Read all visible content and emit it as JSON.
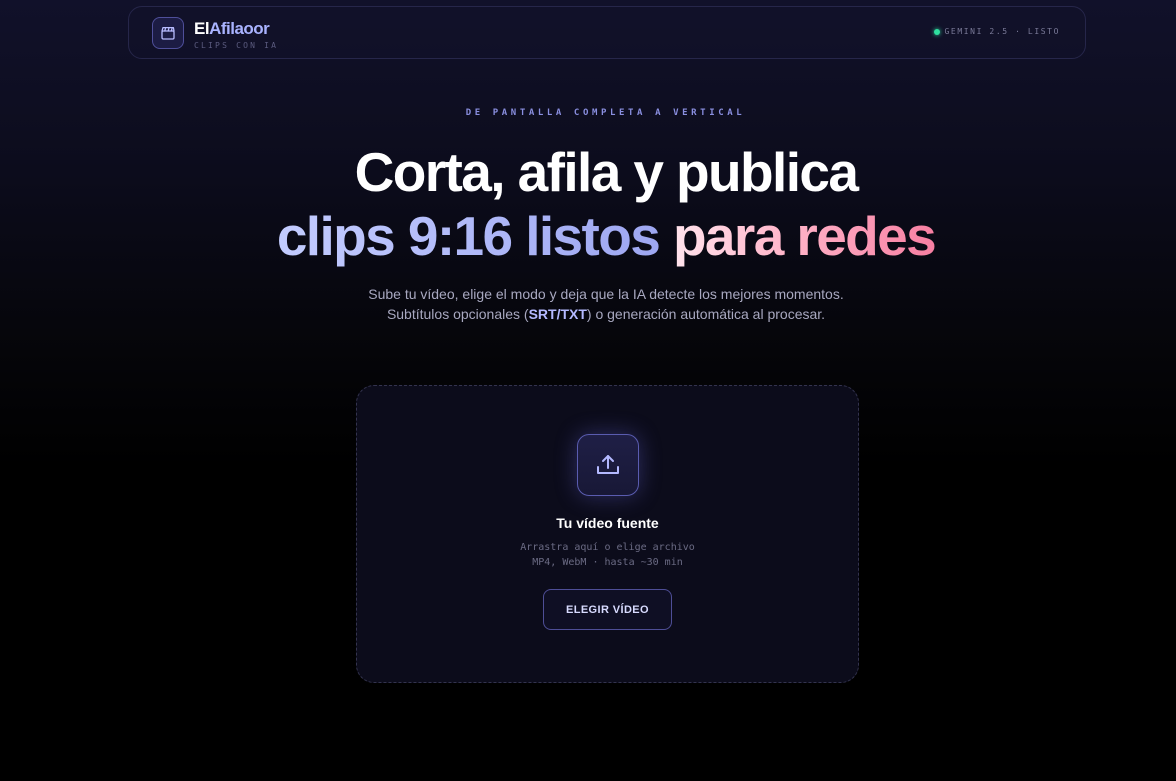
{
  "header": {
    "brand_part1": "El",
    "brand_part2": "Afilaoor",
    "tagline": "CLIPS CON IA",
    "status": "GEMINI 2.5 · LISTO",
    "status_color": "#2fe0a0",
    "logo_icon": "clapperboard-icon"
  },
  "hero": {
    "eyebrow": "DE PANTALLA COMPLETA A VERTICAL",
    "line1": "Corta, afila y publica",
    "line2_part1": "clips 9:16 listos",
    "line2_part2": "para redes",
    "desc_line1": "Sube tu vídeo, elige el modo y deja que la IA detecte los mejores momentos.",
    "desc_line2_pre": "Subtítulos opcionales (",
    "desc_line2_hl": "SRT/TXT",
    "desc_line2_post": ") o generación automática al procesar."
  },
  "upload": {
    "icon": "upload-icon",
    "title": "Tu vídeo fuente",
    "hint1": "Arrastra aquí o elige archivo",
    "hint2": "MP4, WebM · hasta ~30 min",
    "button_label": "ELEGIR VÍDEO"
  },
  "colors": {
    "accent": "#a9b3ff",
    "pink": "#ffb3c8",
    "background": "#000000"
  }
}
